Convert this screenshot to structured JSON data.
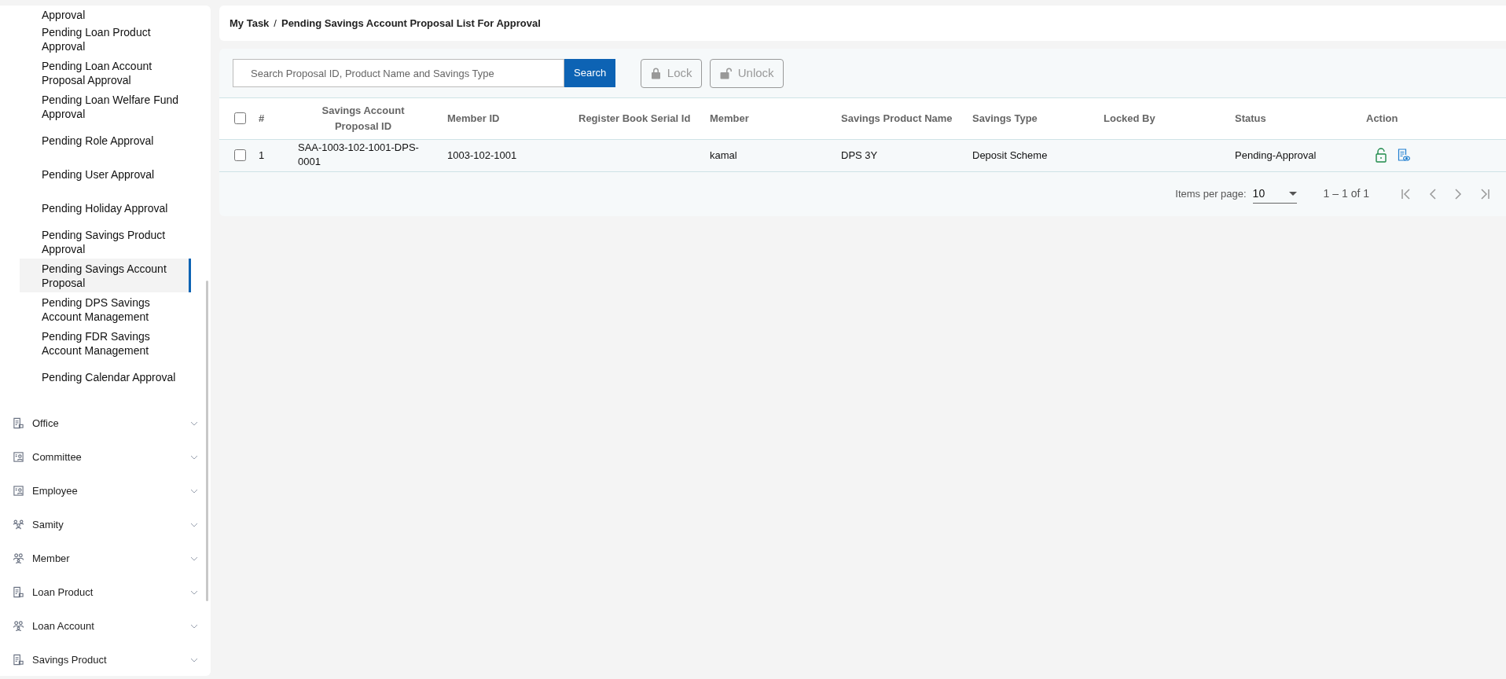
{
  "sidebar": {
    "sub_items": [
      {
        "label": "Approval",
        "selected": false
      },
      {
        "label": "Pending Loan Product Approval",
        "selected": false
      },
      {
        "label": "Pending Loan Account Proposal Approval",
        "selected": false
      },
      {
        "label": "Pending Loan Welfare Fund Approval",
        "selected": false
      },
      {
        "label": "Pending Role Approval",
        "selected": false
      },
      {
        "label": "Pending User Approval",
        "selected": false
      },
      {
        "label": "Pending Holiday Approval",
        "selected": false
      },
      {
        "label": "Pending Savings Product Approval",
        "selected": false
      },
      {
        "label": "Pending Savings Account Proposal",
        "selected": true
      },
      {
        "label": "Pending DPS Savings Account Management",
        "selected": false
      },
      {
        "label": "Pending FDR Savings Account Management",
        "selected": false
      },
      {
        "label": "Pending Calendar Approval",
        "selected": false
      }
    ],
    "groups": [
      {
        "label": "Office",
        "kind": "document",
        "expanded": false
      },
      {
        "label": "Committee",
        "kind": "contact",
        "expanded": false
      },
      {
        "label": "Employee",
        "kind": "contact",
        "expanded": false
      },
      {
        "label": "Samity",
        "kind": "team",
        "expanded": false
      },
      {
        "label": "Member",
        "kind": "group",
        "expanded": false
      },
      {
        "label": "Loan Product",
        "kind": "document",
        "expanded": false
      },
      {
        "label": "Loan Account",
        "kind": "group",
        "expanded": false
      },
      {
        "label": "Savings Product",
        "kind": "document",
        "expanded": false
      }
    ]
  },
  "breadcrumb": {
    "parent": "My Task",
    "separator": "/",
    "current": "Pending Savings Account Proposal List For Approval"
  },
  "toolbar": {
    "search": {
      "placeholder": "Search Proposal ID, Product Name and Savings Type"
    },
    "search_button": "Search",
    "lock_button": {
      "label": "Lock",
      "disabled": true
    },
    "unlock_button": {
      "label": "Unlock",
      "disabled": true
    }
  },
  "table": {
    "select_all_checked": false,
    "columns": [
      "#",
      "Savings Account Proposal ID",
      "Member ID",
      "Register Book Serial Id",
      "Member",
      "Savings Product Name",
      "Savings Type",
      "Locked By",
      "Status",
      "Action"
    ],
    "rows": [
      {
        "checked": false,
        "cells": [
          "1",
          "SAA-1003-102-1001-DPS-0001",
          "1003-102-1001",
          "",
          "kamal",
          "DPS 3Y",
          "Deposit Scheme",
          "",
          "Pending-Approval"
        ]
      }
    ]
  },
  "paginator": {
    "label": "Items per page:",
    "page_size": "10",
    "range": "1 – 1 of 1"
  }
}
